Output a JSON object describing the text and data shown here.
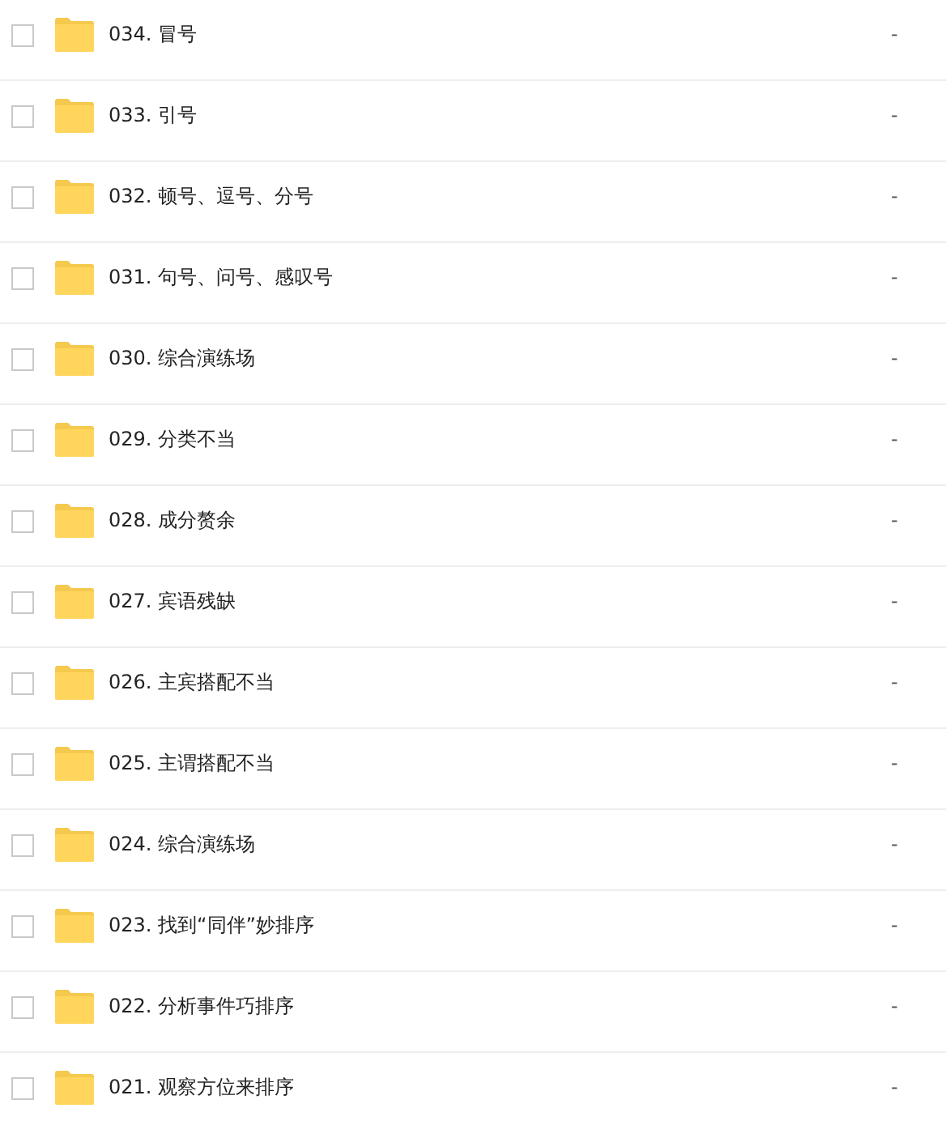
{
  "files": [
    {
      "name": "034. 冒号",
      "checked": false,
      "size": "-"
    },
    {
      "name": "033. 引号",
      "checked": false,
      "size": "-"
    },
    {
      "name": "032. 顿号、逗号、分号",
      "checked": false,
      "size": "-"
    },
    {
      "name": "031. 句号、问号、感叹号",
      "checked": false,
      "size": "-"
    },
    {
      "name": "030. 综合演练场",
      "checked": false,
      "size": "-"
    },
    {
      "name": "029. 分类不当",
      "checked": false,
      "size": "-"
    },
    {
      "name": "028. 成分赘余",
      "checked": false,
      "size": "-"
    },
    {
      "name": "027. 宾语残缺",
      "checked": false,
      "size": "-"
    },
    {
      "name": "026. 主宾搭配不当",
      "checked": false,
      "size": "-"
    },
    {
      "name": "025. 主谓搭配不当",
      "checked": false,
      "size": "-"
    },
    {
      "name": "024. 综合演练场",
      "checked": false,
      "size": "-"
    },
    {
      "name": "023. 找到“同伴”妙排序",
      "checked": false,
      "size": "-"
    },
    {
      "name": "022. 分析事件巧排序",
      "checked": false,
      "size": "-"
    },
    {
      "name": "021. 观察方位来排序",
      "checked": false,
      "size": "-"
    }
  ]
}
